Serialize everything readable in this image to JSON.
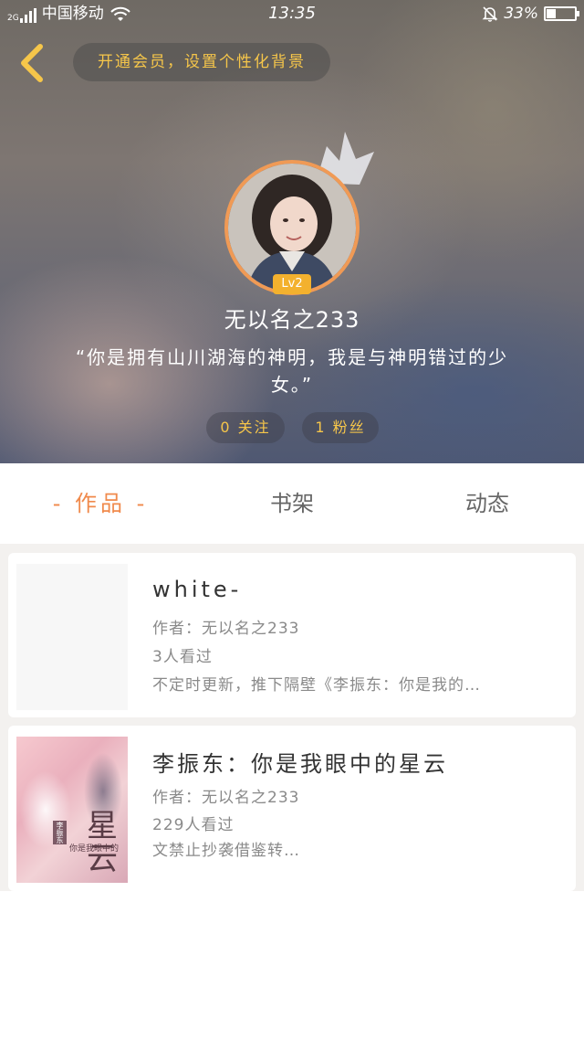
{
  "status_bar": {
    "network_type": "2G",
    "carrier": "中国移动",
    "time": "13:35",
    "battery_percent": "33%",
    "battery_level": 0.33
  },
  "header": {
    "vip_banner": "开通会员，设置个性化背景",
    "level": "Lv2",
    "username": "无以名之233",
    "bio": "“你是拥有山川湖海的神明，我是与神明错过的少女。”",
    "following": "0 关注",
    "followers": "1 粉丝"
  },
  "tabs": [
    {
      "label": "- 作品 -",
      "active": true
    },
    {
      "label": "书架",
      "active": false
    },
    {
      "label": "动态",
      "active": false
    }
  ],
  "books": [
    {
      "title": "white-",
      "author": "作者：无以名之233",
      "views": "3人看过",
      "description": "不定时更新，推下隔壁《李振东：你是我的…"
    },
    {
      "title": "李振东：你是我眼中的星云",
      "author": "作者：无以名之233",
      "views": "229人看过",
      "description": "文禁止抄袭借鉴转…",
      "cover_title": "星云",
      "cover_tag": "李振东",
      "cover_subtitle": "你是我眼中的"
    }
  ],
  "colors": {
    "accent": "#f08a4c",
    "gold": "#f6c64a",
    "avatar_ring": "#f09a55",
    "level_badge": "#f3b12e"
  }
}
